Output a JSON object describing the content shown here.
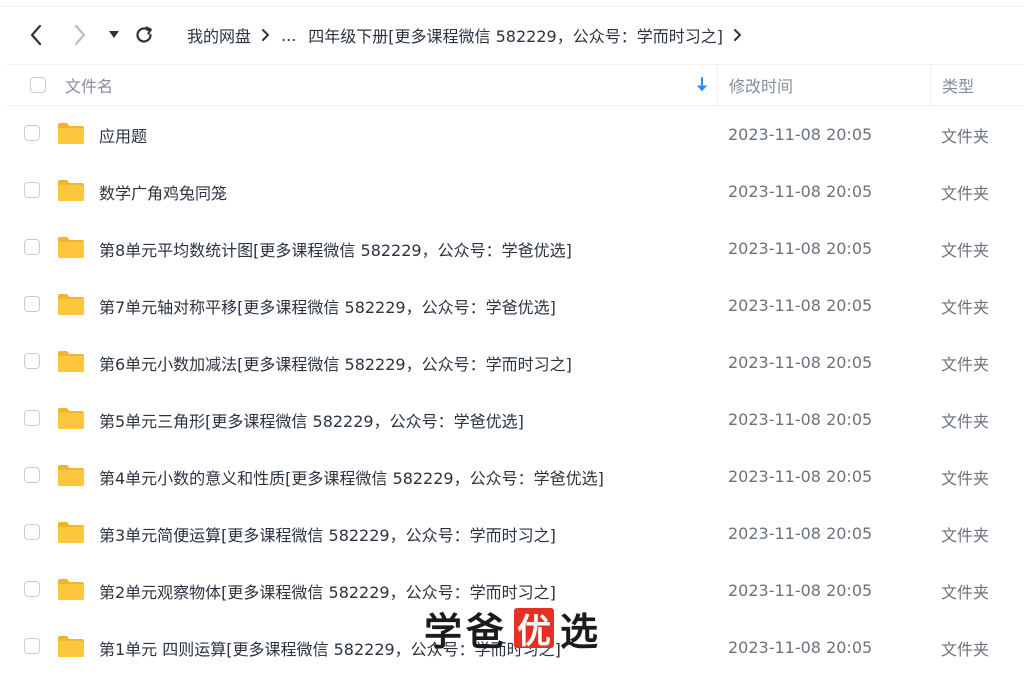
{
  "nav": {
    "breadcrumb": {
      "root": "我的网盘",
      "ellipsis": "...",
      "current": "四年级下册[更多课程微信 582229，公众号：学而时习之]"
    }
  },
  "table": {
    "headers": {
      "name": "文件名",
      "modified": "修改时间",
      "type": "类型"
    },
    "rows": [
      {
        "name": "应用题",
        "modified": "2023-11-08 20:05",
        "type": "文件夹"
      },
      {
        "name": "数学广角鸡兔同笼",
        "modified": "2023-11-08 20:05",
        "type": "文件夹"
      },
      {
        "name": "第8单元平均数统计图[更多课程微信 582229，公众号：学爸优选]",
        "modified": "2023-11-08 20:05",
        "type": "文件夹"
      },
      {
        "name": "第7单元轴对称平移[更多课程微信 582229，公众号：学爸优选]",
        "modified": "2023-11-08 20:05",
        "type": "文件夹"
      },
      {
        "name": "第6单元小数加减法[更多课程微信 582229，公众号：学而时习之]",
        "modified": "2023-11-08 20:05",
        "type": "文件夹"
      },
      {
        "name": "第5单元三角形[更多课程微信 582229，公众号：学爸优选]",
        "modified": "2023-11-08 20:05",
        "type": "文件夹"
      },
      {
        "name": "第4单元小数的意义和性质[更多课程微信 582229，公众号：学爸优选]",
        "modified": "2023-11-08 20:05",
        "type": "文件夹"
      },
      {
        "name": "第3单元简便运算[更多课程微信 582229，公众号：学而时习之]",
        "modified": "2023-11-08 20:05",
        "type": "文件夹"
      },
      {
        "name": "第2单元观察物体[更多课程微信 582229，公众号：学而时习之]",
        "modified": "2023-11-08 20:05",
        "type": "文件夹"
      },
      {
        "name": "第1单元 四则运算[更多课程微信 582229，公众号：学而时习之]",
        "modified": "2023-11-08 20:05",
        "type": "文件夹"
      }
    ]
  },
  "watermark": {
    "chars": [
      "学",
      "爸",
      "优",
      "选"
    ]
  },
  "colors": {
    "folder": "#fcc73c",
    "folder_dark": "#f3b32a",
    "sort_arrow": "#2b8cf0",
    "watermark_box": "#e53124"
  },
  "icons": {
    "back": "chevron-left-icon",
    "forward": "chevron-right-icon",
    "dropdown": "caret-down-icon",
    "refresh": "refresh-icon",
    "folder": "folder-icon",
    "sort": "sort-down-arrow-icon"
  }
}
